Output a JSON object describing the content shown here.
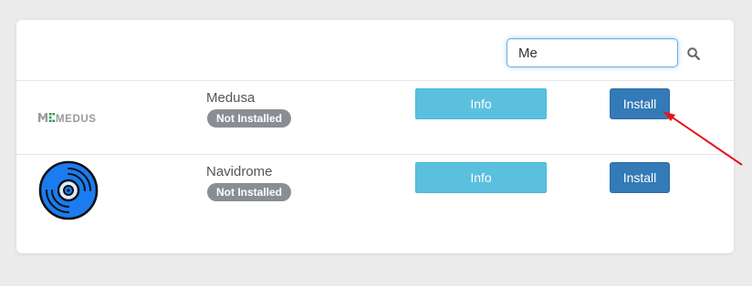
{
  "search": {
    "value": "Me",
    "icon": "search-icon"
  },
  "apps": [
    {
      "name": "Medusa",
      "logo_text": "MEDUSA",
      "status": "Not Installed",
      "info_label": "Info",
      "install_label": "Install",
      "icon": "medusa-logo"
    },
    {
      "name": "Navidrome",
      "status": "Not Installed",
      "info_label": "Info",
      "install_label": "Install",
      "icon": "navidrome-logo"
    }
  ],
  "colors": {
    "info": "#5bc0de",
    "install": "#337ab7",
    "badge": "#888e94",
    "focus_border": "#66afe9",
    "annotation_arrow": "#e8141b",
    "navidrome_disc": "#1a7cf0",
    "medusa_accent": "#2d9a46"
  }
}
